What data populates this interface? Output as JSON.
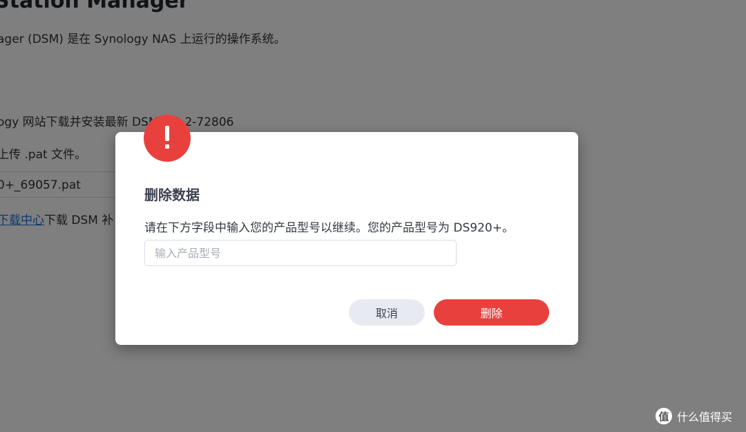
{
  "background_page": {
    "title": "Station Manager",
    "description": "ager (DSM) 是在 Synology NAS 上运行的操作系统。",
    "step_download": "ogy 网站下载并安装最新 DSM 7.2.2-72806",
    "step_upload": "上传 .pat 文件。",
    "file_name": "0+_69057.pat",
    "download_center_link": "下载中心",
    "download_center_suffix": "下载 DSM 补"
  },
  "dialog": {
    "icon": "exclamation-icon",
    "title": "删除数据",
    "message": "请在下方字段中输入您的产品型号以继续。您的产品型号为 DS920+。",
    "input_value": "",
    "input_placeholder": "输入产品型号",
    "cancel_label": "取消",
    "delete_label": "删除"
  },
  "watermark": {
    "logo_glyph": "值",
    "text": "什么值得买"
  },
  "colors": {
    "accent_red": "#e8413d",
    "cancel_bg": "#e7ebf1",
    "overlay": "rgba(0,0,0,0.5)",
    "link_blue": "#1e6fd9"
  }
}
